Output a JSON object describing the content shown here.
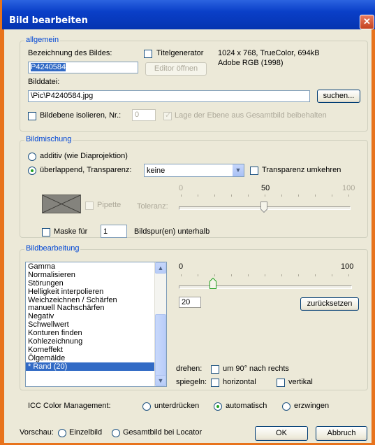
{
  "window": {
    "title": "Bild bearbeiten",
    "close_glyph": "✕"
  },
  "allgemein": {
    "legend": "allgemein",
    "bezeichnung_label": "Bezeichnung des Bildes:",
    "bezeichnung_value": "P4240584",
    "titelgenerator_label": "Titelgenerator",
    "editor_button": "Editor öffnen",
    "info_line1": "1024 x 768, TrueColor, 694kB",
    "info_line2": "Adobe RGB (1998)",
    "bilddatei_label": "Bilddatei:",
    "bilddatei_value": "\\Pic\\P4240584.jpg",
    "suchen_button": "suchen...",
    "isolieren_label": "Bildebene isolieren, Nr.:",
    "isolieren_value": "0",
    "lage_label": "Lage der Ebene aus Gesamtbild beibehalten"
  },
  "bildmischung": {
    "legend": "Bildmischung",
    "additiv_label": "additiv (wie Diaprojektion)",
    "ueberlappend_label": "überlappend, Transparenz:",
    "transparenz_value": "keine",
    "umkehren_label": "Transparenz umkehren",
    "slider_min": "0",
    "slider_mid": "50",
    "slider_max": "100",
    "slider_value_fraction": 0.5,
    "pipette_label": "Pipette",
    "toleranz_label": "Toleranz:",
    "maske_label": "Maske für",
    "maske_value": "1",
    "bildspur_label": "Bildspur(en) unterhalb"
  },
  "bildbearbeitung": {
    "legend": "Bildbearbeitung",
    "filters": [
      "Gamma",
      "Normalisieren",
      "Störungen",
      "Helligkeit interpolieren",
      "Weichzeichnen / Schärfen",
      "manuell Nachschärfen",
      "Negativ",
      "Schwellwert",
      "Konturen finden",
      "Kohlezeichnung",
      "Korneffekt",
      "Ölgemälde",
      "* Rand (20)"
    ],
    "selected_index": 12,
    "slider_min": "0",
    "slider_max": "100",
    "slider_value": "20",
    "slider_value_fraction": 0.2,
    "reset_button": "zurücksetzen",
    "drehen_label": "drehen:",
    "drehen_option": "um 90° nach rechts",
    "spiegeln_label": "spiegeln:",
    "horizontal_label": "horizontal",
    "vertikal_label": "vertikal"
  },
  "icc": {
    "label": "ICC Color Management:",
    "options": [
      "unterdrücken",
      "automatisch",
      "erzwingen"
    ],
    "selected": "automatisch"
  },
  "footer": {
    "vorschau_label": "Vorschau:",
    "einzelbild_label": "Einzelbild",
    "gesamtbild_label": "Gesamtbild bei Locator",
    "ok_button": "OK",
    "abbruch_button": "Abbruch"
  },
  "colors": {
    "titlebar": "#0a3fc8",
    "accent_selection": "#316ac5",
    "legend_text": "#0046d5",
    "frame": "#e8731c"
  }
}
